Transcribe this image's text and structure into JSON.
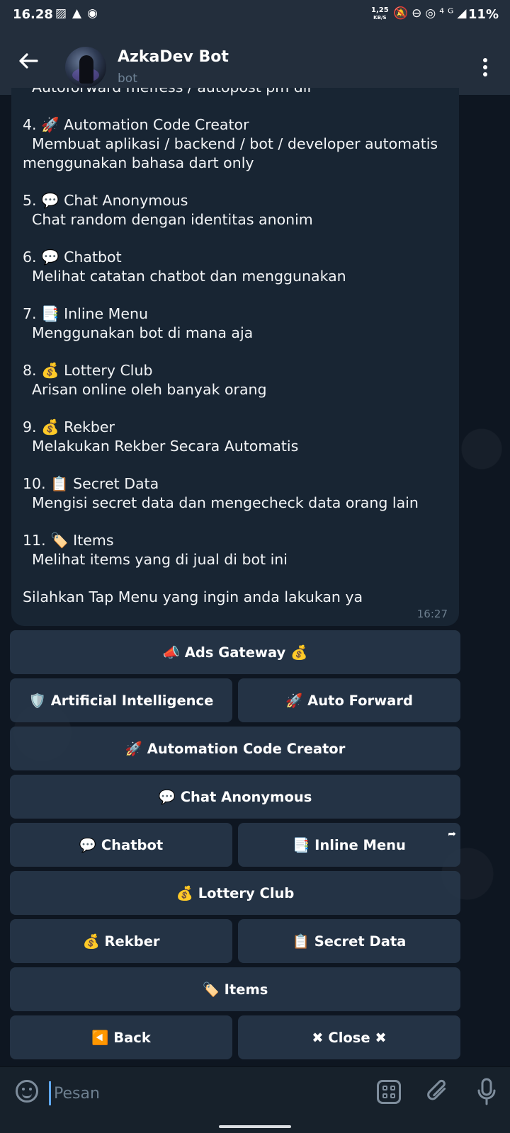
{
  "status_bar": {
    "time": "16.28",
    "left_icons": "▨▲◉",
    "speed_value": "1,25",
    "speed_unit": "KB/S",
    "right_icons": "🔕⊖◎⁴ᴳ◢",
    "battery": "11%"
  },
  "header": {
    "title": "AzkaDev Bot",
    "subtitle": "bot"
  },
  "message": {
    "cut_line": "  Autoforward meffess / autopost pm dll",
    "items": [
      {
        "title": "4. 🚀 Automation Code Creator",
        "desc": "  Membuat aplikasi / backend / bot / developer automatis",
        "desc2": "menggunakan bahasa dart only"
      },
      {
        "title": "5. 💬 Chat Anonymous",
        "desc": "  Chat random dengan identitas anonim"
      },
      {
        "title": "6. 💬 Chatbot",
        "desc": "  Melihat catatan chatbot dan menggunakan"
      },
      {
        "title": "7. 📑 Inline Menu",
        "desc": "  Menggunakan bot di mana aja"
      },
      {
        "title": "8. 💰 Lottery Club",
        "desc": "  Arisan online oleh banyak orang"
      },
      {
        "title": "9. 💰 Rekber",
        "desc": "  Melakukan Rekber Secara Automatis"
      },
      {
        "title": "10. 📋 Secret Data",
        "desc": "  Mengisi secret data dan mengecheck data orang lain"
      },
      {
        "title": "11. 🏷️ Items",
        "desc": "  Melihat items yang di jual di bot ini"
      }
    ],
    "footer": "Silahkan Tap Menu yang ingin anda lakukan ya",
    "time": "16:27"
  },
  "keyboard": {
    "ads_gateway": "📣 Ads Gateway 💰",
    "artificial_intelligence": "🛡️ Artificial Intelligence",
    "auto_forward": "🚀 Auto Forward",
    "automation_code_creator": "🚀 Automation Code Creator",
    "chat_anonymous": "💬 Chat Anonymous",
    "chatbot": "💬 Chatbot",
    "inline_menu": "📑 Inline Menu",
    "inline_share": "➦",
    "lottery_club": "💰 Lottery Club",
    "rekber": "💰 Rekber",
    "secret_data": "📋 Secret Data",
    "items": "🏷️ Items",
    "back": "◀️ Back",
    "close": "✖ Close ✖"
  },
  "input": {
    "placeholder": "Pesan"
  },
  "colors": {
    "header_bg": "#232e3c",
    "bubble_bg": "#182533",
    "button_bg": "#28384a",
    "caret": "#5fa8f0"
  }
}
